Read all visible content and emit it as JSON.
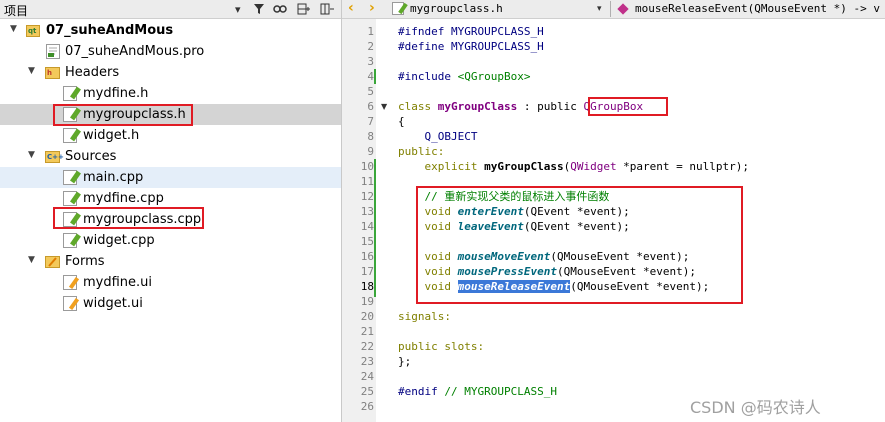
{
  "project_pane": {
    "title": "项目",
    "toolbar_icons": [
      "chevron-down-icon",
      "filter-icon",
      "link-icon",
      "split-add-icon",
      "close-split-icon"
    ]
  },
  "tree": [
    {
      "label": "07_suheAndMous",
      "type": "project",
      "expanded": true
    },
    {
      "label": "07_suheAndMous.pro",
      "type": "pro-file"
    },
    {
      "label": "Headers",
      "type": "folder",
      "expanded": true,
      "tag": "h"
    },
    {
      "label": "mydfine.h",
      "type": "header"
    },
    {
      "label": "mygroupclass.h",
      "type": "header",
      "selected": true
    },
    {
      "label": "widget.h",
      "type": "header"
    },
    {
      "label": "Sources",
      "type": "folder",
      "expanded": true,
      "tag": "C++"
    },
    {
      "label": "main.cpp",
      "type": "source",
      "hover": true
    },
    {
      "label": "mydfine.cpp",
      "type": "source"
    },
    {
      "label": "mygroupclass.cpp",
      "type": "source"
    },
    {
      "label": "widget.cpp",
      "type": "source"
    },
    {
      "label": "Forms",
      "type": "folder",
      "expanded": true
    },
    {
      "label": "mydfine.ui",
      "type": "ui"
    },
    {
      "label": "widget.ui",
      "type": "ui"
    }
  ],
  "editor": {
    "file_tab": "mygroupclass.h",
    "symbol": "mouseReleaseEvent(QMouseEvent *) -> v",
    "current_line": 18,
    "line_numbers": [
      "1",
      "2",
      "3",
      "4",
      "5",
      "6",
      "7",
      "8",
      "9",
      "10",
      "11",
      "12",
      "13",
      "14",
      "15",
      "16",
      "17",
      "18",
      "19",
      "20",
      "21",
      "22",
      "23",
      "24",
      "25",
      "26"
    ],
    "code": {
      "l1": "#ifndef MYGROUPCLASS_H",
      "l2": "#define MYGROUPCLASS_H",
      "l4_kw": "#include ",
      "l4_str": "<QGroupBox>",
      "l6_kw": "class ",
      "l6_name": "myGroupClass",
      "l6_mid": " : public ",
      "l6_base": "QGroupBox",
      "l7": "{",
      "l8": "    Q_OBJECT",
      "l9": "public:",
      "l10_kw": "    explicit ",
      "l10_fn": "myGroupClass",
      "l10_p1": "(",
      "l10_type": "QWidget",
      "l10_rest": " *parent = nullptr);",
      "l12": "    // 重新实现父类的鼠标进入事件函数",
      "l13_kw": "    void ",
      "l13_fn": "enterEvent",
      "l13_rest": "(QEvent *event);",
      "l14_kw": "    void ",
      "l14_fn": "leaveEvent",
      "l14_rest": "(QEvent *event);",
      "l16_kw": "    void ",
      "l16_fn": "mouseMoveEvent",
      "l16_rest": "(QMouseEvent *event);",
      "l17_kw": "    void ",
      "l17_fn": "mousePressEvent",
      "l17_rest": "(QMouseEvent *event);",
      "l18_kw": "    void ",
      "l18_fn": "mouseReleaseEvent",
      "l18_rest": "(QMouseEvent *event);",
      "l20": "signals:",
      "l22": "public slots:",
      "l23": "};",
      "l25_kw": "#endif ",
      "l25_cmt": "// MYGROUPCLASS_H"
    }
  },
  "watermark": "CSDN @码农诗人",
  "colors": {
    "highlight_box": "#e01b24",
    "selection": "#3b78d8",
    "modified_bar": "#3aa63a"
  }
}
